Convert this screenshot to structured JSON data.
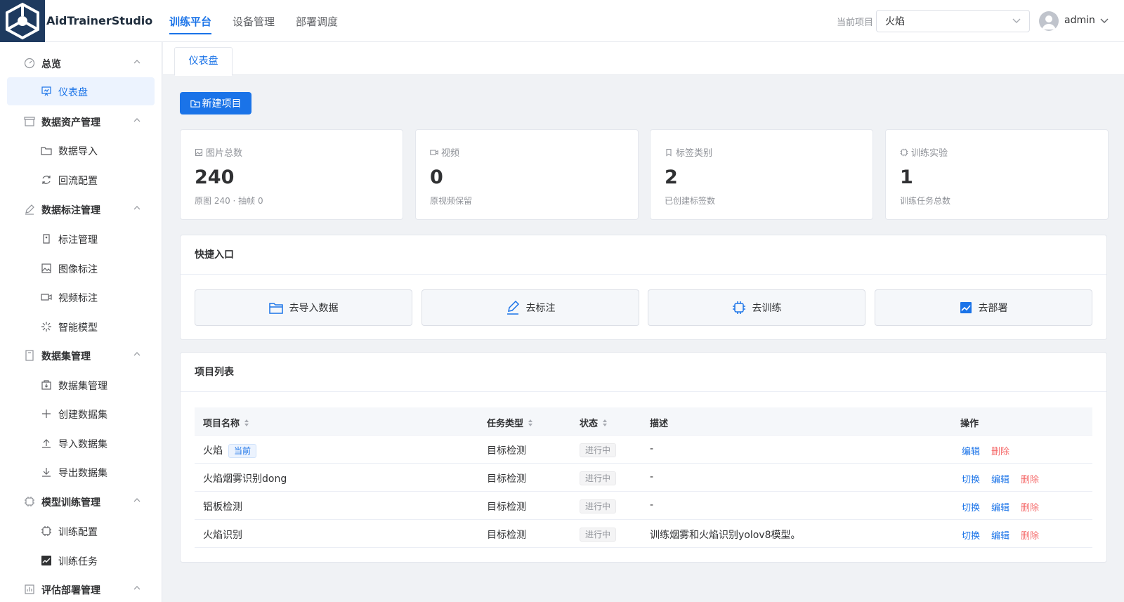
{
  "header": {
    "brand": "AidTrainerStudio",
    "nav": [
      "训练平台",
      "设备管理",
      "部署调度"
    ],
    "current_project_label": "当前项目",
    "current_project_value": "火焰",
    "user": "admin",
    "accent_color": "#1a73e8"
  },
  "sidebar": {
    "groups": [
      {
        "label": "总览",
        "icon": "dashboard-icon",
        "items": [
          {
            "label": "仪表盘",
            "icon": "presentation-icon",
            "active": true
          }
        ]
      },
      {
        "label": "数据资产管理",
        "icon": "box-icon",
        "items": [
          {
            "label": "数据导入",
            "icon": "folder-icon"
          },
          {
            "label": "回流配置",
            "icon": "refresh-icon"
          }
        ]
      },
      {
        "label": "数据标注管理",
        "icon": "pen-icon",
        "items": [
          {
            "label": "标注管理",
            "icon": "tag-icon"
          },
          {
            "label": "图像标注",
            "icon": "image-icon"
          },
          {
            "label": "视频标注",
            "icon": "video-icon"
          },
          {
            "label": "智能模型",
            "icon": "magic-icon"
          }
        ]
      },
      {
        "label": "数据集管理",
        "icon": "notebook-icon",
        "items": [
          {
            "label": "数据集管理",
            "icon": "package-icon"
          },
          {
            "label": "创建数据集",
            "icon": "plus-icon"
          },
          {
            "label": "导入数据集",
            "icon": "upload-icon"
          },
          {
            "label": "导出数据集",
            "icon": "download-icon"
          }
        ]
      },
      {
        "label": "模型训练管理",
        "icon": "cpu-icon",
        "items": [
          {
            "label": "训练配置",
            "icon": "cpu-icon"
          },
          {
            "label": "训练任务",
            "icon": "chart-icon"
          }
        ]
      },
      {
        "label": "评估部署管理",
        "icon": "report-icon",
        "items": []
      }
    ]
  },
  "tabs": [
    "仪表盘"
  ],
  "main": {
    "new_project_button": "新建项目",
    "stats": [
      {
        "label": "图片总数",
        "icon": "picture-icon",
        "value": "240",
        "sub": "原图 240 · 抽帧 0"
      },
      {
        "label": "视频",
        "icon": "video-icon",
        "value": "0",
        "sub": "原视频保留"
      },
      {
        "label": "标签类别",
        "icon": "bookmark-icon",
        "value": "2",
        "sub": "已创建标签数"
      },
      {
        "label": "训练实验",
        "icon": "cpu-icon",
        "value": "1",
        "sub": "训练任务总数"
      }
    ],
    "quick": {
      "title": "快捷入口",
      "items": [
        {
          "label": "去导入数据",
          "icon": "folder-icon"
        },
        {
          "label": "去标注",
          "icon": "pen-icon"
        },
        {
          "label": "去训练",
          "icon": "cpu-icon"
        },
        {
          "label": "去部署",
          "icon": "chart-icon"
        }
      ]
    },
    "projects": {
      "title": "项目列表",
      "columns": [
        "项目名称",
        "任务类型",
        "状态",
        "描述",
        "操作"
      ],
      "current_tag": "当前",
      "actions": {
        "switch": "切换",
        "edit": "编辑",
        "delete": "删除"
      },
      "rows": [
        {
          "name": "火焰",
          "type": "目标检测",
          "status": "进行中",
          "desc": "-",
          "current": true
        },
        {
          "name": "火焰烟雾识别dong",
          "type": "目标检测",
          "status": "进行中",
          "desc": "-",
          "current": false
        },
        {
          "name": "铝板检测",
          "type": "目标检测",
          "status": "进行中",
          "desc": "-",
          "current": false
        },
        {
          "name": "火焰识别",
          "type": "目标检测",
          "status": "进行中",
          "desc": "训练烟雾和火焰识别yolov8模型。",
          "current": false
        }
      ]
    }
  }
}
